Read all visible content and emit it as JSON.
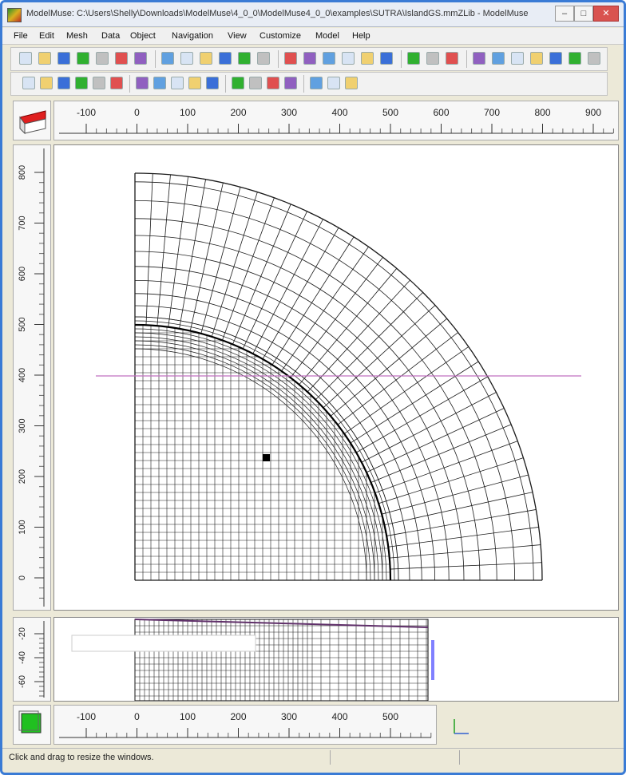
{
  "window": {
    "title": "ModelMuse: C:\\Users\\Shelly\\Downloads\\ModelMuse\\4_0_0\\ModelMuse4_0_0\\examples\\SUTRA\\IslandGS.mmZLib - ModelMuse",
    "minimize_label": "–",
    "maximize_label": "□",
    "close_label": "✕"
  },
  "menu": {
    "items": [
      "File",
      "Edit",
      "Mesh",
      "Data",
      "Object",
      "Navigation",
      "View",
      "Customize",
      "Model",
      "Help"
    ]
  },
  "toolbar": {
    "row1_icons": [
      "new-file-icon",
      "open-file-icon",
      "save-icon",
      "run-model-icon",
      "dropdown-arrow-icon",
      "color-grid-icon",
      "export-icon",
      "grid-icon",
      "grid-layers-icon",
      "import-icon",
      "copy-icon",
      "layers-icon",
      "color-bar-icon",
      "pointer-red-icon",
      "rotate-left-icon",
      "rotate-right-icon",
      "draw-line-icon",
      "draw-polyline-icon",
      "draw-spline-icon",
      "select-arrow-icon",
      "color-legend-icon",
      "blue-box-icon",
      "zoom-in-icon",
      "zoom-out-icon",
      "zoom-extents-icon",
      "pan-icon",
      "magnify-box-icon",
      "measure-icon",
      "close-view-icon"
    ],
    "row2_icons": [
      "add-vertex-icon",
      "move-vertex-icon",
      "delete-vertex-icon",
      "split-object-icon",
      "join-objects-icon",
      "edit-box-icon",
      "point-tool-icon",
      "line-tool-icon",
      "circle-tool-icon",
      "polyline-tool-icon",
      "rectangle-tool-icon",
      "vertex-edit-icon",
      "select-object-icon",
      "node-icon",
      "element-active-icon",
      "dropdown-icon",
      "mesh-text-icon",
      "mesh-view-icon"
    ]
  },
  "top_ruler": {
    "ticks": [
      "-100",
      "0",
      "100",
      "200",
      "300",
      "400",
      "500",
      "600",
      "700",
      "800",
      "900"
    ]
  },
  "side_ruler": {
    "ticks": [
      "800",
      "700",
      "600",
      "500",
      "400",
      "300",
      "200",
      "100",
      "0"
    ]
  },
  "bottom_side_ruler": {
    "ticks": [
      "-20",
      "-40",
      "-60"
    ]
  },
  "bottom_ruler": {
    "ticks": [
      "-100",
      "0",
      "100",
      "200",
      "300",
      "400",
      "500"
    ]
  },
  "colors": {
    "cross_section_line": "#c070c0",
    "mesh": "#1a1a1a",
    "accent_corner_red": "#e02020",
    "corner_green": "#20c020",
    "window_border": "#3a7bd5"
  },
  "status": {
    "message": "Click and drag to resize the windows."
  }
}
